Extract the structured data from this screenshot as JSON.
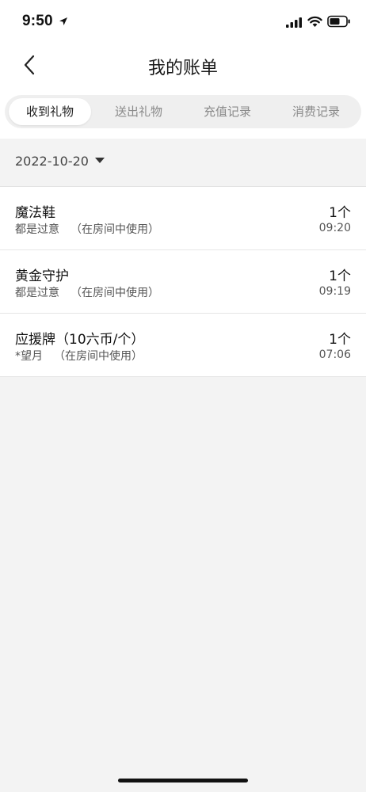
{
  "status_bar": {
    "time": "9:50"
  },
  "nav": {
    "title": "我的账单"
  },
  "tabs": [
    {
      "label": "收到礼物",
      "active": true
    },
    {
      "label": "送出礼物",
      "active": false
    },
    {
      "label": "充值记录",
      "active": false
    },
    {
      "label": "消费记录",
      "active": false
    }
  ],
  "filter": {
    "date": "2022-10-20"
  },
  "records": [
    {
      "name": "魔法鞋",
      "user": "都是过意",
      "note": "（在房间中使用）",
      "qty": "1个",
      "time": "09:20"
    },
    {
      "name": "黄金守护",
      "user": "都是过意",
      "note": "（在房间中使用）",
      "qty": "1个",
      "time": "09:19"
    },
    {
      "name": "应援牌（10六币/个）",
      "user": "*望月",
      "note": "（在房间中使用）",
      "qty": "1个",
      "time": "07:06"
    }
  ],
  "colors": {
    "background": "#f3f3f3",
    "tab_track": "#efefef",
    "text_primary": "#111111",
    "text_secondary": "#555555"
  },
  "icons": [
    "location-arrow-icon",
    "signal-icon",
    "wifi-icon",
    "battery-icon",
    "back-chevron-icon",
    "caret-down-icon"
  ]
}
